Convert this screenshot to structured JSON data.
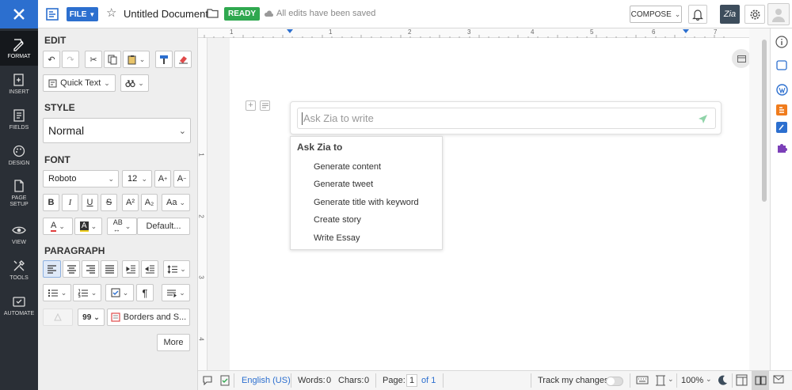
{
  "topbar": {
    "file_label": "FILE",
    "doc_title": "Untitled Document",
    "status_badge": "READY",
    "save_status": "All edits have been saved",
    "compose_label": "COMPOSE",
    "zia_label": "Zia"
  },
  "leftnav": {
    "items": [
      {
        "label": "FORMAT",
        "icon": "format-icon"
      },
      {
        "label": "INSERT",
        "icon": "insert-icon"
      },
      {
        "label": "FIELDS",
        "icon": "fields-icon"
      },
      {
        "label": "DESIGN",
        "icon": "design-icon"
      },
      {
        "label": "PAGE SETUP",
        "icon": "page-setup-icon"
      },
      {
        "label": "VIEW",
        "icon": "view-icon"
      },
      {
        "label": "TOOLS",
        "icon": "tools-icon"
      },
      {
        "label": "AUTOMATE",
        "icon": "automate-icon"
      }
    ]
  },
  "panel": {
    "edit_title": "EDIT",
    "quick_text": "Quick Text",
    "style_title": "STYLE",
    "style_value": "Normal",
    "font_title": "FONT",
    "font_family": "Roboto",
    "font_size": "12",
    "default_label": "Default...",
    "paragraph_title": "PARAGRAPH",
    "borders_label": "Borders and S...",
    "more_label": "More",
    "case_label": "Aa",
    "grow_label": "A",
    "shrink_label": "A",
    "super_label": "A²",
    "sub_label": "A₂",
    "bold": "B",
    "italic": "I",
    "underline": "U",
    "strike": "S",
    "quote": "99",
    "pilcrow": "¶"
  },
  "zia": {
    "placeholder": "Ask Zia to write",
    "menu_title": "Ask Zia to",
    "menu_items": [
      "Generate content",
      "Generate tweet",
      "Generate title with keyword",
      "Create story",
      "Write Essay"
    ]
  },
  "ruler": {
    "top_numbers": [
      "1",
      "1",
      "2",
      "3",
      "4",
      "5",
      "6",
      "7"
    ],
    "left_numbers": [
      "1",
      "2",
      "3",
      "4"
    ]
  },
  "status": {
    "language": "English (US)",
    "words_label": "Words:",
    "words": "0",
    "chars_label": "Chars:",
    "chars": "0",
    "page_label": "Page:",
    "page": "1",
    "page_of": "of 1",
    "track_changes": "Track my changes",
    "zoom": "100%"
  },
  "colors": {
    "brand": "#2c6fcf",
    "nav": "#2a2f36",
    "ready": "#2fa84f"
  }
}
